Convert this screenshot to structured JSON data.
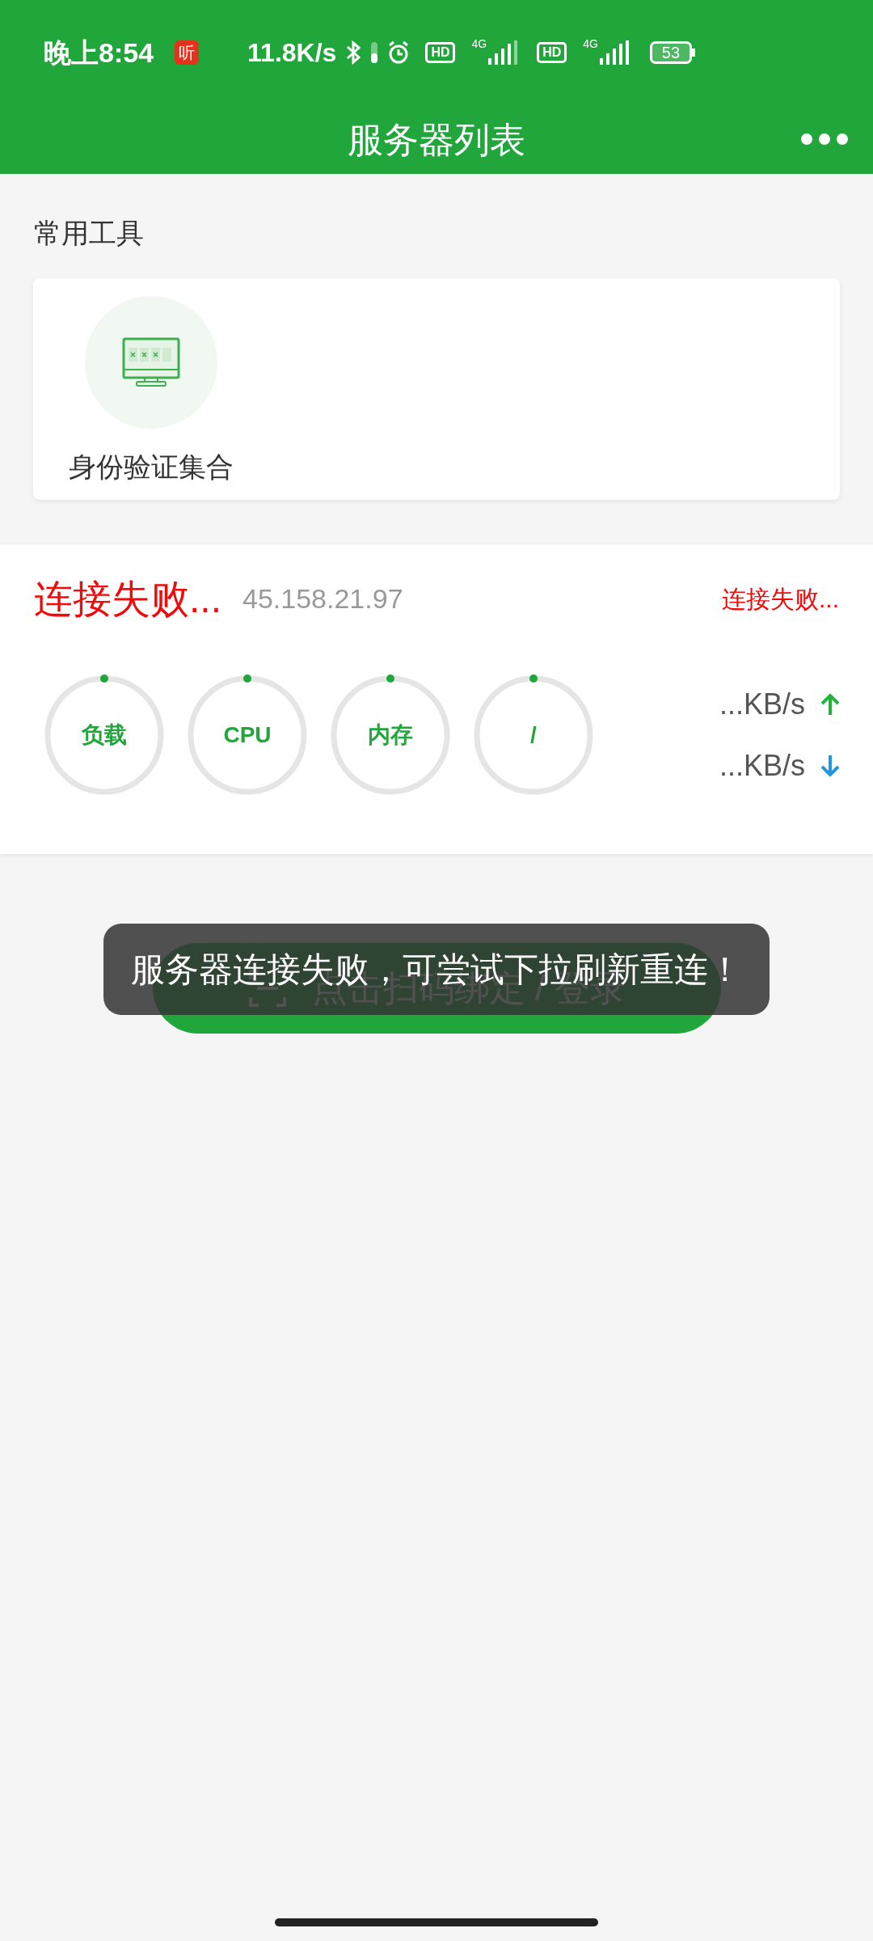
{
  "status_bar": {
    "time": "晚上8:54",
    "app_badge": "听",
    "net_speed": "11.8K/s",
    "hd_1": "HD",
    "network_1": "4G",
    "hd_2": "HD",
    "network_2": "4G",
    "battery": "53"
  },
  "nav_bar": {
    "title": "服务器列表"
  },
  "tools_section": {
    "title": "常用工具",
    "tools": [
      {
        "label": "身份验证集合"
      }
    ]
  },
  "servers": [
    {
      "name": "连接失败...",
      "ip": "45.158.21.97",
      "status": "连接失败...",
      "gauges": [
        {
          "label": "负载",
          "level": 0
        },
        {
          "label": "CPU",
          "level": 0
        },
        {
          "label": "内存",
          "level": 0
        },
        {
          "label": "/",
          "level": 0
        }
      ],
      "upload": "...KB/s",
      "download": "...KB/s"
    }
  ],
  "scan_button": {
    "label": "点击扫码绑定 / 登录"
  },
  "toast": {
    "message": "服务器连接失败，可尝试下拉刷新重连！"
  }
}
